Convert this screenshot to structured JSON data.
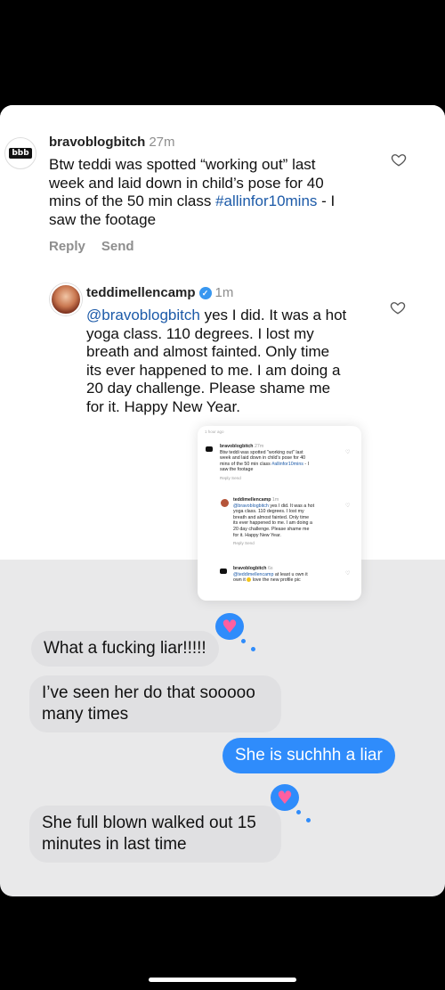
{
  "comments": [
    {
      "username": "bravoblogbitch",
      "time": "27m",
      "avatar_text": "bbb",
      "text_lines": [
        "Btw teddi was spotted “working out” last",
        "week and laid down in child’s pose for 40",
        "mins of the 50 min class "
      ],
      "hashtag": "#allinfor10mins",
      "text_tail": " - I",
      "text_last": "saw the footage",
      "reply": "Reply",
      "send": "Send"
    },
    {
      "username": "teddimellencamp",
      "time": "1m",
      "verified": true,
      "mention": "@bravoblogbitch",
      "text_first": " yes I did. It was a hot",
      "text_lines": [
        "yoga class. 110 degrees. I lost my",
        "breath and almost fainted. Only time",
        "its ever happened to me. I am doing a",
        "20 day challenge.  Please shame me",
        "for it.  Happy New Year."
      ]
    }
  ],
  "embed": {
    "header_time": "1 hour ago",
    "c1": {
      "username": "bravoblogbitch",
      "time": "27m",
      "lines": [
        "Btw teddi was spotted \"working out\" last",
        "week and laid down in child's pose for 40",
        "mins of the 50 min class "
      ],
      "hashtag": "#allinfor10mins",
      "tail": " - I",
      "last": "saw the footage",
      "actions": "Reply    Send"
    },
    "c2": {
      "username": "teddimellencamp",
      "time": "1m",
      "mention": "@bravoblogbitch",
      "first": " yes I did. It was a hot",
      "lines": [
        "yoga class. 110 degrees. I lost my",
        "breath and almost fainted. Only time",
        "its ever happened to me. I am doing a",
        "20 day challenge.  Please shame me",
        "for it.  Happy New Year."
      ],
      "actions": "Reply    Send"
    },
    "c3": {
      "username": "bravoblogbitch",
      "time": "6s",
      "mention": "@teddimellencamp",
      "first": " at least u own it",
      "second_pre": "own it ",
      "second_post": " love the new profile pic"
    }
  },
  "messages": [
    {
      "side": "left",
      "text": "What a fucking liar!!!!!",
      "tapback": "heart"
    },
    {
      "side": "left",
      "text_lines": [
        "I’ve seen her do that sooooo",
        "many times"
      ]
    },
    {
      "side": "right",
      "text": "She is suchhh a liar"
    },
    {
      "side": "left",
      "text_lines": [
        "She full blown walked out 15",
        "minutes in last time"
      ],
      "tapback": "heart"
    }
  ],
  "colors": {
    "imessage_blue": "#2f8cfb",
    "imessage_gray": "#e0e0e2",
    "hashtag": "#1c5aa8",
    "tapback_heart": "#ff5fa0"
  },
  "icons": [
    "heart-outline-icon",
    "verified-badge-icon",
    "heart-tapback-icon",
    "smiley-emoji-icon"
  ]
}
